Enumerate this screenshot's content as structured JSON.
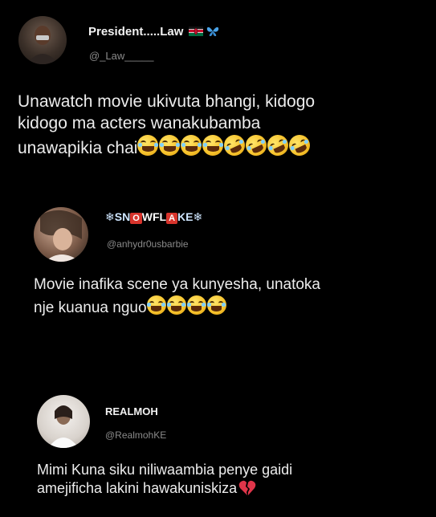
{
  "post1": {
    "name": "President.....Law",
    "handle": "@_Law_____",
    "text_lines": [
      "Unawatch movie ukivuta bhangi, kidogo",
      "kidogo ma acters wanakubamba",
      "unawapikia chai"
    ],
    "emoji_count": 8
  },
  "post2": {
    "name_parts": [
      "❄SN",
      "O",
      "WFL",
      "A",
      "KE❄"
    ],
    "handle": "@anhydr0usbarbie",
    "text_lines": [
      "Movie inafika scene ya kunyesha, unatoka",
      "nje kuanua nguo"
    ],
    "emoji_count": 4
  },
  "post3": {
    "name": "REALMOH",
    "handle": "@RealmohKE",
    "text_lines": [
      "Mimi Kuna siku niliwaambia penye gaidi",
      "amejificha lakini hawakuniskiza"
    ]
  },
  "colors": {
    "background": "#000000",
    "text": "#ececec",
    "handle": "#8a8a8a",
    "badge": "#d8342c"
  },
  "icons": [
    "kenya-flag-icon",
    "butterfly-icon",
    "laughing-emoji-icon",
    "broken-heart-icon",
    "snowflake-icon"
  ]
}
